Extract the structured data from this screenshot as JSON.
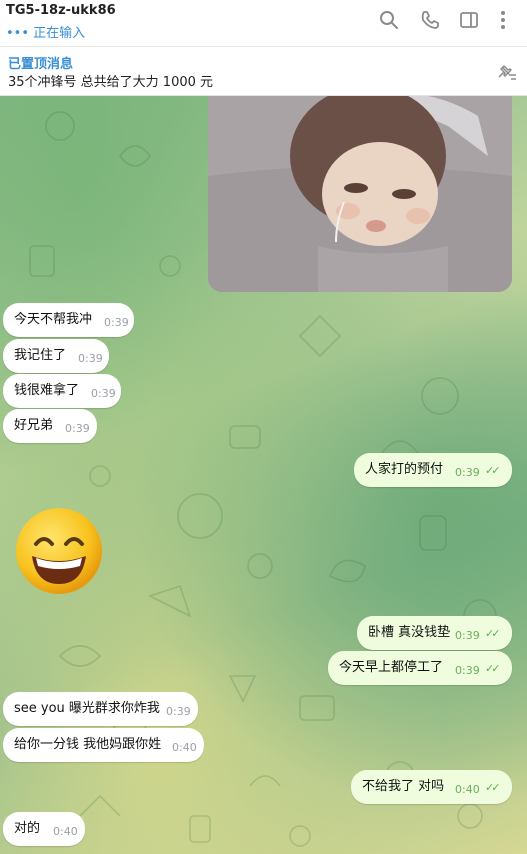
{
  "header": {
    "title": "TG5-18z-ukk86",
    "status": "••• 正在输入"
  },
  "pinned": {
    "title": "已置顶消息",
    "text": "35个冲锋号 总共给了大力 1000 元"
  },
  "messages": [
    {
      "text": "今天不帮我冲",
      "time": "0:39"
    },
    {
      "text": "我记住了",
      "time": "0:39"
    },
    {
      "text": "钱很难拿了",
      "time": "0:39"
    },
    {
      "text": "好兄弟",
      "time": "0:39"
    },
    {
      "text": "人家打的预付",
      "time": "0:39"
    },
    {
      "text": "卧槽 真没钱垫",
      "time": "0:39"
    },
    {
      "text": "今天早上都停工了",
      "time": "0:39"
    },
    {
      "text": "see you 曝光群求你炸我",
      "time": "0:39"
    },
    {
      "text": "给你一分钱 我他妈跟你姓",
      "time": "0:40"
    },
    {
      "text": "不给我了 对吗",
      "time": "0:40"
    },
    {
      "text": "对的",
      "time": "0:40"
    }
  ]
}
